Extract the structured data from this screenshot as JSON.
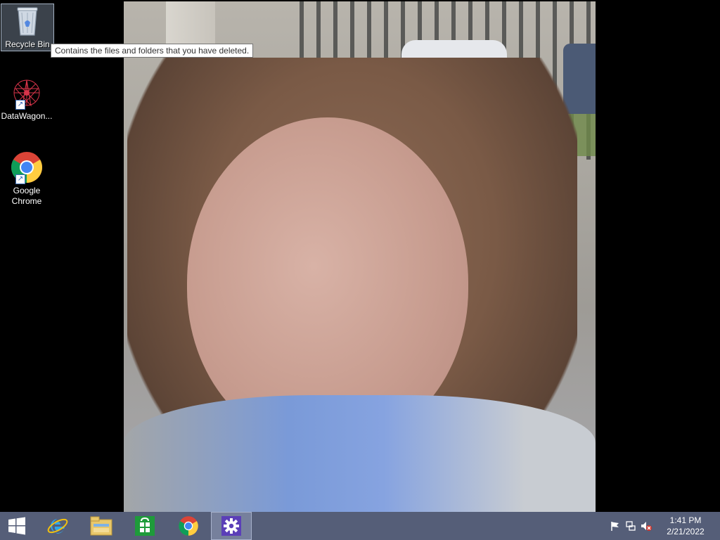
{
  "desktop": {
    "icons": [
      {
        "label": "Recycle Bin",
        "icon": "recycle-bin-icon"
      },
      {
        "label": "DataWagon...",
        "icon": "datawagon-icon"
      },
      {
        "label": "Google Chrome",
        "icon": "chrome-icon"
      }
    ],
    "tooltip": "Contains the files and folders that you have deleted."
  },
  "taskbar": {
    "buttons": [
      {
        "icon": "windows-start-icon"
      },
      {
        "icon": "internet-explorer-icon"
      },
      {
        "icon": "file-explorer-icon"
      },
      {
        "icon": "windows-store-icon"
      },
      {
        "icon": "chrome-icon"
      },
      {
        "icon": "settings-gear-icon"
      }
    ],
    "tray": {
      "icons": [
        "action-center-flag-icon",
        "network-icon",
        "volume-muted-icon"
      ],
      "time": "1:41 PM",
      "date": "2/21/2022"
    }
  },
  "colors": {
    "taskbar": "#5c6682",
    "accent": "#3a5fb0"
  }
}
